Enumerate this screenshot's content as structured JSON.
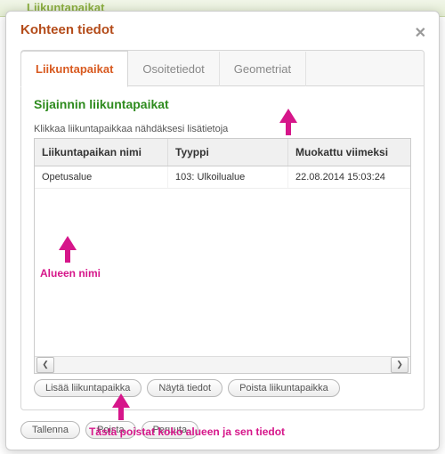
{
  "backdrop_brand": "Liikuntapaikat",
  "dialog": {
    "title": "Kohteen tiedot"
  },
  "tabs": {
    "t0": "Liikuntapaikat",
    "t1": "Osoitetiedot",
    "t2": "Geometriat"
  },
  "section_title": "Sijainnin liikuntapaikat",
  "hint": "Klikkaa liikuntapaikkaa nähdäksesi lisätietoja",
  "grid": {
    "headers": {
      "h0": "Liikuntapaikan nimi",
      "h1": "Tyyppi",
      "h2": "Muokattu viimeksi"
    },
    "rows": [
      {
        "c0": "Opetusalue",
        "c1": "103: Ulkoilualue",
        "c2": "22.08.2014 15:03:24"
      }
    ]
  },
  "panel_buttons": {
    "b0": "Lisää liikuntapaikka",
    "b1": "Näytä tiedot",
    "b2": "Poista liikuntapaikka"
  },
  "footer_buttons": {
    "b0": "Tallenna",
    "b1": "Poista",
    "b2": "Peruuta"
  },
  "annotations": {
    "a0": "Alueen nimi",
    "a1": "Tästä poistat koko alueen ja sen tiedot"
  }
}
